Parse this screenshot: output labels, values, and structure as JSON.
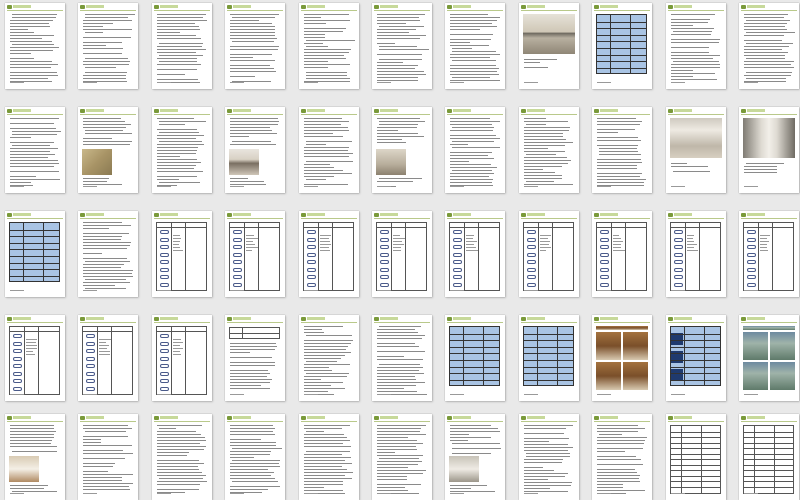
{
  "viewer": {
    "background": "#e9e9e9",
    "columns": 11,
    "pages": [
      {
        "kind": "text"
      },
      {
        "kind": "text"
      },
      {
        "kind": "text"
      },
      {
        "kind": "text"
      },
      {
        "kind": "text"
      },
      {
        "kind": "text"
      },
      {
        "kind": "text"
      },
      {
        "kind": "photo",
        "scene": "interior-kitchen"
      },
      {
        "kind": "blue-table"
      },
      {
        "kind": "text"
      },
      {
        "kind": "text"
      },
      {
        "kind": "text"
      },
      {
        "kind": "text-photo",
        "scene": "cabinet"
      },
      {
        "kind": "text"
      },
      {
        "kind": "text-photo",
        "scene": "person"
      },
      {
        "kind": "text"
      },
      {
        "kind": "text-photo",
        "scene": "room"
      },
      {
        "kind": "text"
      },
      {
        "kind": "text"
      },
      {
        "kind": "text"
      },
      {
        "kind": "photo",
        "scene": "hallway"
      },
      {
        "kind": "photo",
        "scene": "corridor"
      },
      {
        "kind": "blue-table"
      },
      {
        "kind": "text"
      },
      {
        "kind": "oval-table"
      },
      {
        "kind": "oval-table"
      },
      {
        "kind": "oval-table"
      },
      {
        "kind": "oval-table"
      },
      {
        "kind": "oval-table"
      },
      {
        "kind": "oval-table"
      },
      {
        "kind": "oval-table"
      },
      {
        "kind": "oval-table"
      },
      {
        "kind": "oval-table"
      },
      {
        "kind": "oval-table"
      },
      {
        "kind": "oval-table"
      },
      {
        "kind": "oval-table"
      },
      {
        "kind": "small-table"
      },
      {
        "kind": "text"
      },
      {
        "kind": "text"
      },
      {
        "kind": "blue-table"
      },
      {
        "kind": "blue-table"
      },
      {
        "kind": "photo-grid",
        "scene": "doors"
      },
      {
        "kind": "blue-table-dark"
      },
      {
        "kind": "photo-grid",
        "scene": "gym"
      },
      {
        "kind": "text-photo",
        "scene": "bed"
      },
      {
        "kind": "text"
      },
      {
        "kind": "text"
      },
      {
        "kind": "text"
      },
      {
        "kind": "text"
      },
      {
        "kind": "text"
      },
      {
        "kind": "text-photo",
        "scene": "doorway"
      },
      {
        "kind": "text"
      },
      {
        "kind": "text"
      },
      {
        "kind": "table-lines"
      },
      {
        "kind": "table-lines"
      }
    ]
  }
}
